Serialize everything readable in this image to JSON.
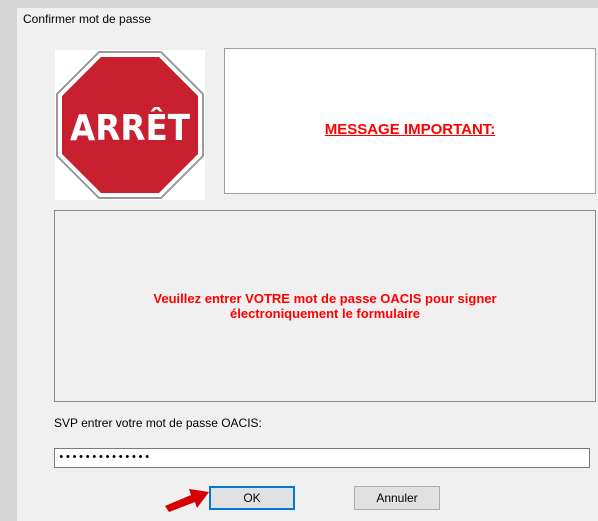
{
  "window": {
    "title": "Confirmer mot de passe"
  },
  "stop_sign": {
    "text": "ARRÊT",
    "fill": "#c8202f"
  },
  "message_box": {
    "title": "MESSAGE IMPORTANT:"
  },
  "notice": {
    "line1": "Veuillez entrer VOTRE mot de passe OACIS pour signer",
    "line2": "électroniquement le formulaire"
  },
  "password": {
    "label": "SVP entrer votre mot de passe OACIS:",
    "value": "••••••••••••••"
  },
  "buttons": {
    "ok": "OK",
    "cancel": "Annuler"
  },
  "colors": {
    "alert_text": "#ff0000",
    "arrow": "#d40000",
    "focus": "#0078d7"
  }
}
